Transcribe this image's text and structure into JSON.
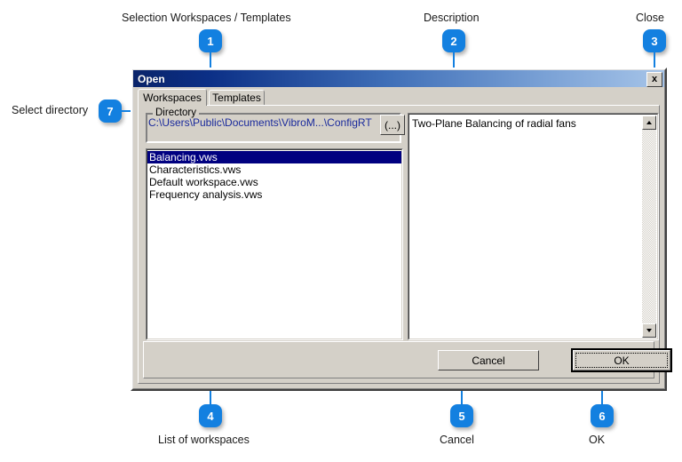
{
  "dialog": {
    "title": "Open",
    "close_icon": "x",
    "tabs": [
      {
        "label": "Workspaces",
        "active": true
      },
      {
        "label": "Templates",
        "active": false
      }
    ],
    "directory_group": {
      "legend": "Directory",
      "path": "C:\\Users\\Public\\Documents\\VibroM...\\ConfigRT",
      "browse_label": "(...)"
    },
    "workspace_list": [
      {
        "name": "Balancing.vws",
        "selected": true
      },
      {
        "name": "Characteristics.vws",
        "selected": false
      },
      {
        "name": "Default workspace.vws",
        "selected": false
      },
      {
        "name": "Frequency analysis.vws",
        "selected": false
      }
    ],
    "description": {
      "text": "Two-Plane Balancing of radial fans",
      "scroll_up_icon": "triangle-up",
      "scroll_down_icon": "triangle-down"
    },
    "buttons": {
      "cancel": "Cancel",
      "ok": "OK"
    }
  },
  "annotations": {
    "accent_color": "#1380e0",
    "items": [
      {
        "number": "1",
        "label": "Selection Workspaces / Templates"
      },
      {
        "number": "2",
        "label": "Description"
      },
      {
        "number": "3",
        "label": "Close"
      },
      {
        "number": "4",
        "label": "List of workspaces"
      },
      {
        "number": "5",
        "label": "Cancel"
      },
      {
        "number": "6",
        "label": "OK"
      },
      {
        "number": "7",
        "label": "Select directory"
      }
    ]
  }
}
